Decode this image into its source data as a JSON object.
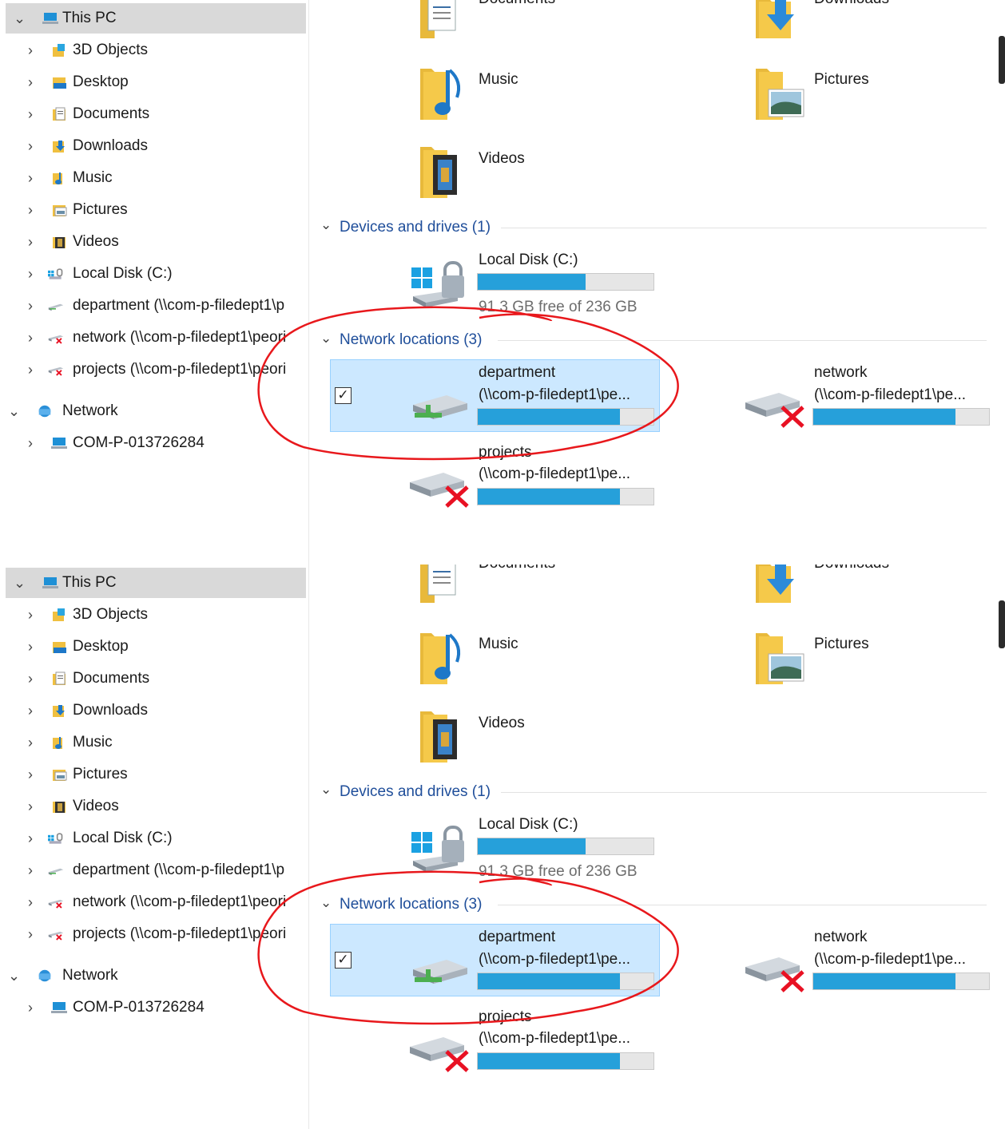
{
  "nav": {
    "this_pc": "This PC",
    "items": [
      {
        "label": "3D Objects",
        "icon": "3d-objects-icon"
      },
      {
        "label": "Desktop",
        "icon": "desktop-folder-icon"
      },
      {
        "label": "Documents",
        "icon": "documents-folder-icon"
      },
      {
        "label": "Downloads",
        "icon": "downloads-folder-icon"
      },
      {
        "label": "Music",
        "icon": "music-folder-icon"
      },
      {
        "label": "Pictures",
        "icon": "pictures-folder-icon"
      },
      {
        "label": "Videos",
        "icon": "videos-folder-icon"
      },
      {
        "label": "Local Disk (C:)",
        "icon": "local-disk-icon"
      },
      {
        "label": "department (\\\\com-p-filedept1\\p",
        "icon": "network-drive-icon"
      },
      {
        "label": "network (\\\\com-p-filedept1\\peori",
        "icon": "disconnected-drive-icon"
      },
      {
        "label": "projects (\\\\com-p-filedept1\\peori",
        "icon": "disconnected-drive-icon"
      }
    ],
    "network": "Network",
    "computer": "COM-P-013726284"
  },
  "folders": {
    "documents": "Documents",
    "downloads": "Downloads",
    "music": "Music",
    "pictures": "Pictures",
    "videos": "Videos"
  },
  "devices": {
    "header": "Devices and drives (1)",
    "local_disk": {
      "name": "Local Disk (C:)",
      "free_text": "91.3 GB free of 236 GB",
      "used_fraction": 0.613
    }
  },
  "network_locations": {
    "header": "Network locations (3)",
    "items": [
      {
        "name": "department",
        "path": "(\\\\com-p-filedept1\\pe...",
        "used_fraction": 0.81,
        "selected": true,
        "checked": true,
        "status": "connected"
      },
      {
        "name": "network",
        "path": "(\\\\com-p-filedept1\\pe...",
        "used_fraction": 0.81,
        "selected": false,
        "status": "disconnected"
      },
      {
        "name": "projects",
        "path": "(\\\\com-p-filedept1\\pe...",
        "used_fraction": 0.81,
        "selected": false,
        "status": "disconnected"
      }
    ]
  },
  "colors": {
    "accent": "#26a0da",
    "selection_bg": "#cce8ff",
    "selection_border": "#99d1ff",
    "group_header": "#1f4e9a",
    "annotation": "#e8181c"
  },
  "chevrons": {
    "expanded": "⌄",
    "collapsed": "›"
  },
  "checkmark": "✓"
}
